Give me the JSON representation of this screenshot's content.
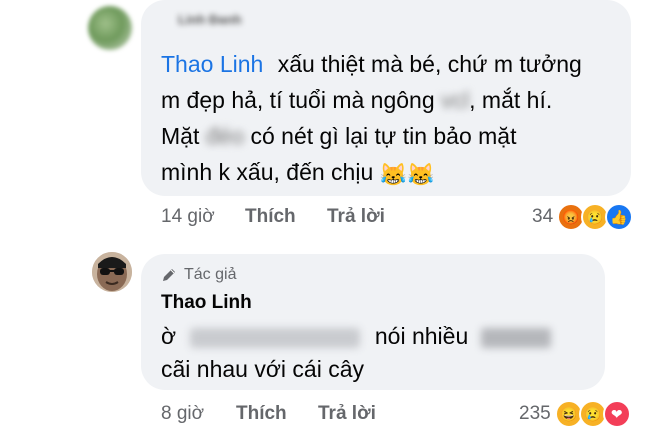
{
  "comment1": {
    "author_name": "Linh Đanh",
    "mention": "Thao Linh",
    "lines": [
      " xấu thiệt mà bé, chứ m tưởng",
      "m đẹp hả, tí tuổi mà ngông",
      "Mặt",
      "có nét gì lại tự tin bảo mặt",
      "mình k xấu, đến chịu"
    ],
    "blur_words": [
      "vcl",
      "đéo"
    ],
    "line2_tail": ", mắt hí.",
    "emoji": "😹😹",
    "time": "14 giờ",
    "like_label": "Thích",
    "reply_label": "Trả lời",
    "reaction_count": "34",
    "reactions": [
      "angry-icon",
      "sad-icon",
      "like-icon"
    ]
  },
  "comment2": {
    "badge_label": "Tác giả",
    "author_name": "Thao Linh",
    "line1_start": "ờ",
    "line1_mid": "nói nhiều",
    "line2": "cãi nhau với cái cây",
    "time": "8 giờ",
    "like_label": "Thích",
    "reply_label": "Trả lời",
    "reaction_count": "235",
    "reactions": [
      "haha-icon",
      "sad-icon",
      "love-icon"
    ]
  },
  "colors": {
    "mention": "#1b74e4",
    "bubble": "#f0f2f5",
    "meta": "#65676b"
  }
}
